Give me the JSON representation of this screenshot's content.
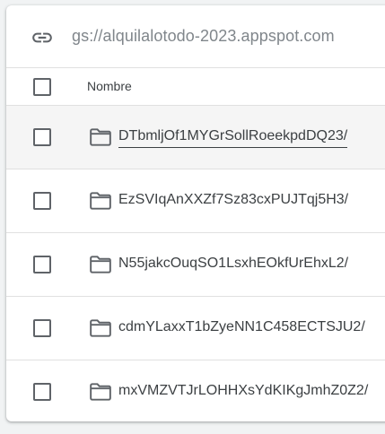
{
  "path": {
    "icon": "link-icon",
    "text": "gs://alquilalotodo-2023.appspot.com"
  },
  "table": {
    "header": {
      "name_label": "Nombre"
    },
    "rows": [
      {
        "label": "DTbmljOf1MYGrSollRoeekpdDQ23/",
        "icon": "folder-icon",
        "hovered": true
      },
      {
        "label": "EzSVIqAnXXZf7Sz83cxPUJTqj5H3/",
        "icon": "folder-icon",
        "hovered": false
      },
      {
        "label": "N55jakcOuqSO1LsxhEOkfUrEhxL2/",
        "icon": "folder-icon",
        "hovered": false
      },
      {
        "label": "cdmYLaxxT1bZyeNN1C458ECTSJU2/",
        "icon": "folder-icon",
        "hovered": false
      },
      {
        "label": "mxVMZVTJrLOHHXsYdKIKgJmhZ0Z2/",
        "icon": "folder-icon",
        "hovered": false
      }
    ]
  },
  "colors": {
    "hover_row": "#f5f5f5",
    "text": "#3c4043",
    "muted": "#80868b",
    "icon": "#5f6368"
  }
}
